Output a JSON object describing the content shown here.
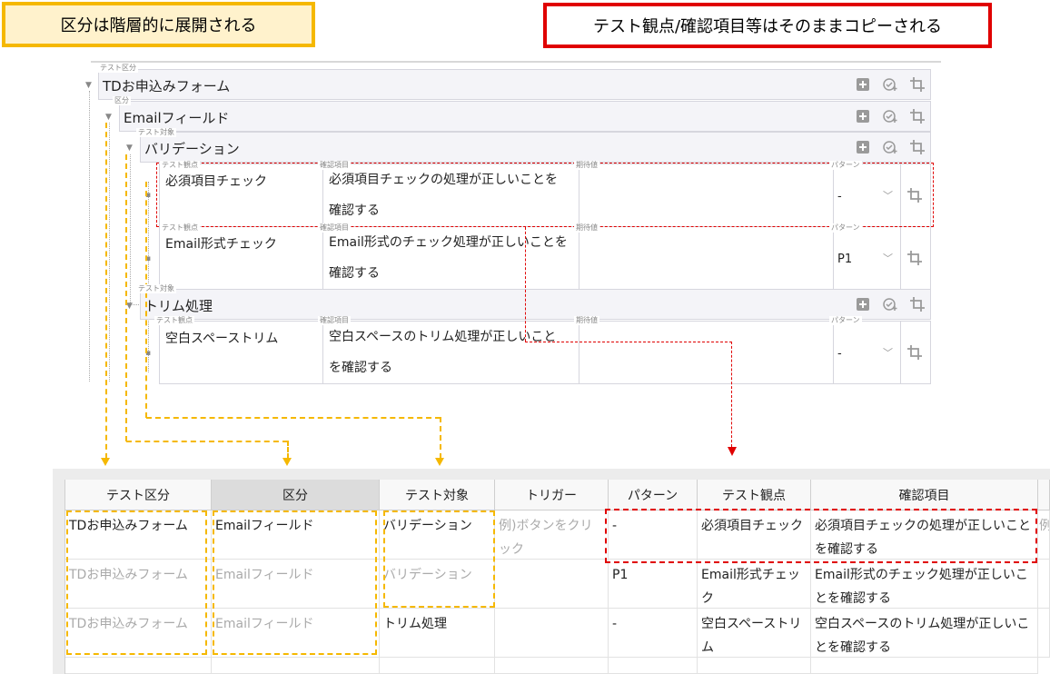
{
  "callouts": {
    "hierarchy": "区分は階層的に展開される",
    "copy": "テスト観点/確認項目等はそのままコピーされる"
  },
  "tree": {
    "small_labels": {
      "test_category": "テスト区分",
      "category": "区分",
      "test_target": "テスト対象",
      "viewpoint": "テスト観点",
      "check_item": "確認項目",
      "expected": "期待値",
      "pattern": "パターン"
    },
    "root": "TDお申込みフォーム",
    "field": "Emailフィールド",
    "target1": "バリデーション",
    "target2": "トリム処理",
    "rows": [
      {
        "viewpoint": "必須項目チェック",
        "check": "必須項目チェックの処理が正しいことを確認する",
        "check_lines": [
          "必須項目チェックの処理が正しいことを",
          "確認する"
        ],
        "expected": "",
        "pattern": "-"
      },
      {
        "viewpoint": "Email形式チェック",
        "check": "Email形式のチェック処理が正しいことを確認する",
        "check_lines": [
          "Email形式のチェック処理が正しいことを",
          "確認する"
        ],
        "expected": "",
        "pattern": "P1"
      },
      {
        "viewpoint": "空白スペーストリム",
        "check": "空白スペースのトリム処理が正しいことを確認する",
        "check_lines": [
          "空白スペースのトリム処理が正しいこと",
          "を確認する"
        ],
        "expected": "",
        "pattern": "-"
      }
    ]
  },
  "grid": {
    "headers": [
      "テスト区分",
      "区分",
      "テスト対象",
      "トリガー",
      "パターン",
      "テスト観点",
      "確認項目"
    ],
    "trigger_hint": "例)ボタンをクリック",
    "overflow_hint": "例",
    "rows": [
      [
        "TDお申込みフォーム",
        "Emailフィールド",
        "バリデーション",
        "例)ボタンをクリック",
        "-",
        "必須項目チェック",
        "必須項目チェックの処理が正しいことを確認する"
      ],
      [
        "TDお申込みフォーム",
        "Emailフィールド",
        "バリデーション",
        "",
        "P1",
        "Email形式チェック",
        "Email形式のチェック処理が正しいことを確認する"
      ],
      [
        "TDお申込みフォーム",
        "Emailフィールド",
        "トリム処理",
        "",
        "-",
        "空白スペーストリム",
        "空白スペースのトリム処理が正しいことを確認する"
      ]
    ]
  },
  "colors": {
    "yellow_accent": "#f5b800",
    "red_accent": "#e00000",
    "callout_yellow_bg": "#fff2cc"
  },
  "icons": [
    "add-square-icon",
    "add-check-icon",
    "crop-icon",
    "chevron-down-icon"
  ]
}
